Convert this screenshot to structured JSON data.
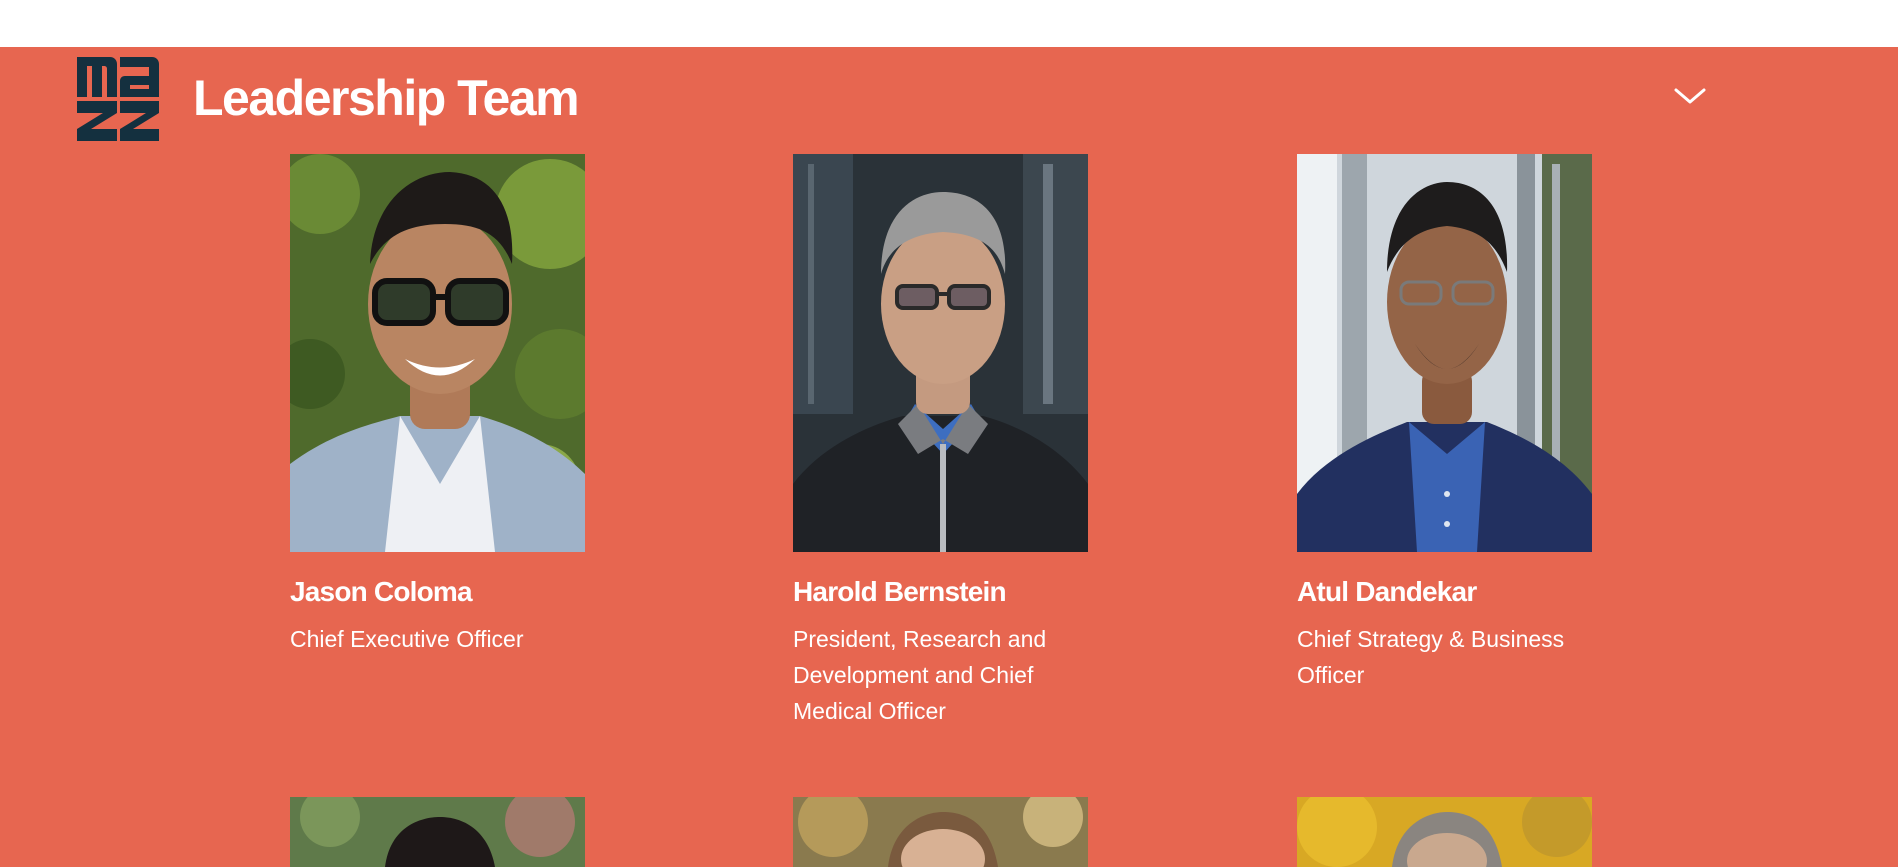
{
  "section": {
    "title": "Leadership Team",
    "colors": {
      "background": "#e76650",
      "text": "#ffffff",
      "logo": "#14303f"
    },
    "toggle_icon": "chevron-down-icon"
  },
  "logo": {
    "icon": "maze-logo-icon"
  },
  "members": [
    {
      "name": "Jason Coloma",
      "title": "Chief Executive Officer"
    },
    {
      "name": "Harold Bernstein",
      "title": "President, Research and Development and Chief Medical Officer"
    },
    {
      "name": "Atul Dandekar",
      "title": "Chief Strategy & Business Officer"
    }
  ]
}
